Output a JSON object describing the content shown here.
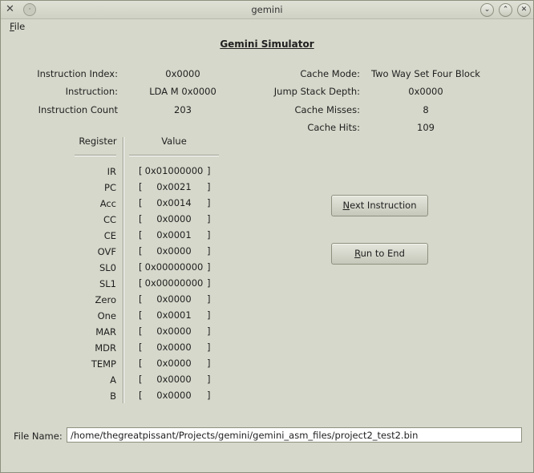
{
  "window": {
    "title": "gemini",
    "pin_glyph": "·",
    "minimize_glyph": "⌄",
    "maximize_glyph": "⌃",
    "close_glyph": "✕"
  },
  "menu": {
    "file_mnemonic": "F",
    "file_rest": "ile"
  },
  "heading": "Gemini Simulator",
  "info_left": [
    {
      "label": "Instruction Index:",
      "value": "0x0000"
    },
    {
      "label": "Instruction:",
      "value": "LDA M 0x0000"
    },
    {
      "label": "Instruction Count",
      "value": "203"
    }
  ],
  "info_right": [
    {
      "label": "Cache Mode:",
      "value": "Two Way Set Four Block"
    },
    {
      "label": "Jump Stack Depth:",
      "value": "0x0000"
    },
    {
      "label": "Cache Misses:",
      "value": "8"
    },
    {
      "label": "Cache Hits:",
      "value": "109"
    }
  ],
  "register_table": {
    "col_register": "Register",
    "col_value": "Value",
    "bracket_open": "[",
    "bracket_close": "]",
    "rows": [
      {
        "name": "IR",
        "value": "0x01000000"
      },
      {
        "name": "PC",
        "value": "0x0021"
      },
      {
        "name": "Acc",
        "value": "0x0014"
      },
      {
        "name": "CC",
        "value": "0x0000"
      },
      {
        "name": "CE",
        "value": "0x0001"
      },
      {
        "name": "OVF",
        "value": "0x0000"
      },
      {
        "name": "SL0",
        "value": "0x00000000"
      },
      {
        "name": "SL1",
        "value": "0x00000000"
      },
      {
        "name": "Zero",
        "value": "0x0000"
      },
      {
        "name": "One",
        "value": "0x0001"
      },
      {
        "name": "MAR",
        "value": "0x0000"
      },
      {
        "name": "MDR",
        "value": "0x0000"
      },
      {
        "name": "TEMP",
        "value": "0x0000"
      },
      {
        "name": "A",
        "value": "0x0000"
      },
      {
        "name": "B",
        "value": "0x0000"
      }
    ]
  },
  "buttons": {
    "next": {
      "mnemonic": "N",
      "rest": "ext Instruction"
    },
    "run": {
      "mnemonic": "R",
      "rest": "un to End"
    }
  },
  "file": {
    "label": "File Name:",
    "value": "/home/thegreatpissant/Projects/gemini/gemini_asm_files/project2_test2.bin"
  }
}
